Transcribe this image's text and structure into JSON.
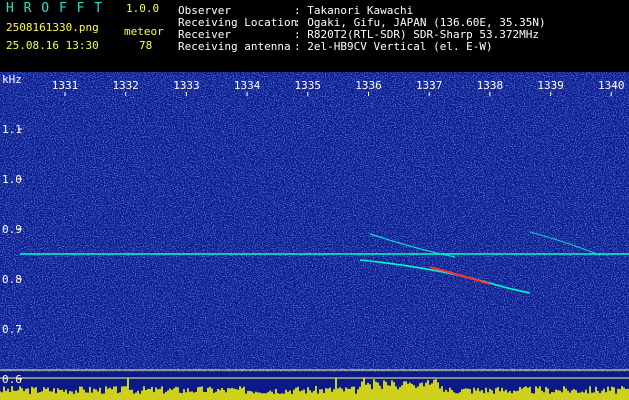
{
  "app": {
    "name": "H R O F F T",
    "version": "1.0.0",
    "filename": "2508161330.png",
    "mode": "meteor",
    "datetime": "25.08.16 13:30",
    "count": "78"
  },
  "info": {
    "observer_label": "Observer",
    "observer_value": ": Takanori Kawachi",
    "location_label": "Receiving Location",
    "location_value": ": Ogaki, Gifu, JAPAN (136.60E, 35.35N)",
    "receiver_label": "Receiver",
    "receiver_value": ": R820T2(RTL-SDR) SDR-Sharp 53.372MHz",
    "antenna_label": "Receiving antenna",
    "antenna_value": ": 2el-HB9CV Vertical (el. E-W)"
  },
  "chart_data": {
    "type": "heatmap",
    "ylabel": "kHz",
    "x_ticks": [
      "1331",
      "1332",
      "1333",
      "1334",
      "1335",
      "1336",
      "1337",
      "1338",
      "1339",
      "1340"
    ],
    "y_ticks": [
      "1.1",
      "1.0",
      "0.9",
      "0.8",
      "0.7",
      "0.6"
    ],
    "ylim": [
      0.58,
      1.2
    ],
    "carrier_khz": 0.85,
    "colors": {
      "background": "#0a1a8a",
      "noise": "#2a4cff",
      "signal": "#00ffd0",
      "hot": "#ff3030",
      "level_bar": "#ffff00",
      "level_line": "#ffff80"
    }
  }
}
